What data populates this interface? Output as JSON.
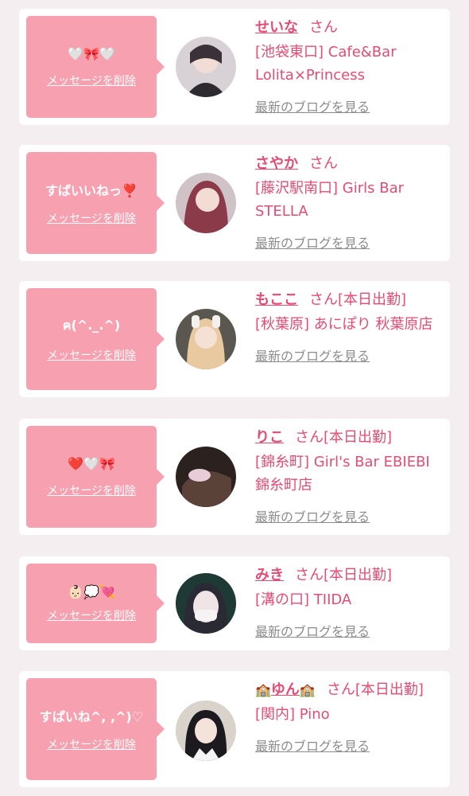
{
  "colors": {
    "accent": "#e24d73",
    "bubble": "#f7a0b0",
    "background": "#f5eef1",
    "link_gray": "#8c8c8c"
  },
  "cards": [
    {
      "message": "🤍🎀🤍",
      "delete_label": "メッセージを削除",
      "name": "せいな",
      "honorific": "さん",
      "shop": "[池袋東口] Cafe&Bar Lolita×Princess",
      "blog_label": "最新のブログを見る"
    },
    {
      "message": "すぱいいねっ❣️",
      "delete_label": "メッセージを削除",
      "name": "さやか",
      "honorific": "さん",
      "shop": "[藤沢駅南口] Girls Bar STELLA",
      "blog_label": "最新のブログを見る"
    },
    {
      "message": "ฅ(^._.^)",
      "delete_label": "メッセージを削除",
      "name": "もここ",
      "honorific": "さん[本日出勤]",
      "shop": "[秋葉原] あにぽり 秋葉原店",
      "blog_label": "最新のブログを見る"
    },
    {
      "message": "❤️🤍🎀",
      "delete_label": "メッセージを削除",
      "name": "りこ",
      "honorific": "さん[本日出勤]",
      "shop": "[錦糸町] Girl's Bar EBIEBI 錦糸町店",
      "blog_label": "最新のブログを見る"
    },
    {
      "message": "👶🏻💭💘",
      "delete_label": "メッセージを削除",
      "name": "みき",
      "honorific": "さん[本日出勤]",
      "shop": "[溝の口] TIIDA",
      "blog_label": "最新のブログを見る"
    },
    {
      "message": "すぱいね^, ,^)♡",
      "delete_label": "メッセージを削除",
      "name_prefix_icon": "🏫",
      "name": "ゆん",
      "name_suffix_icon": "🏫",
      "honorific": "さん[本日出勤]",
      "shop": "[関内] Pino",
      "blog_label": "最新のブログを見る"
    }
  ]
}
